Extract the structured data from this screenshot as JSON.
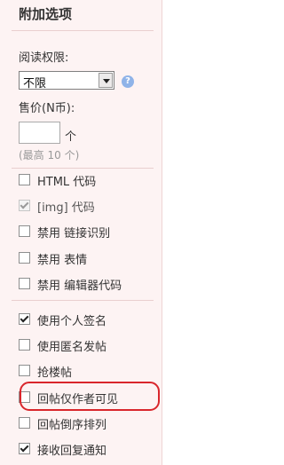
{
  "panel": {
    "title": "附加选项",
    "read_permission_label": "阅读权限:",
    "read_permission_value": "不限",
    "help_glyph": "?",
    "price_label": "售价(N币):",
    "price_value": "",
    "price_unit": "个",
    "price_hint": "(最高 10 个)",
    "options": [
      {
        "label": "HTML 代码",
        "checked": false,
        "disabled": false
      },
      {
        "label": "[img] 代码",
        "checked": true,
        "disabled": true
      },
      {
        "label": "禁用 链接识别",
        "checked": false,
        "disabled": false
      },
      {
        "label": "禁用 表情",
        "checked": false,
        "disabled": false
      },
      {
        "label": "禁用 编辑器代码",
        "checked": false,
        "disabled": false
      },
      {
        "label": "使用个人签名",
        "checked": true,
        "disabled": false
      },
      {
        "label": "使用匿名发帖",
        "checked": false,
        "disabled": false
      },
      {
        "label": "抢楼帖",
        "checked": false,
        "disabled": false
      },
      {
        "label": "回帖仅作者可见",
        "checked": false,
        "disabled": false
      },
      {
        "label": "回帖倒序排列",
        "checked": false,
        "disabled": false
      },
      {
        "label": "接收回复通知",
        "checked": true,
        "disabled": false
      }
    ],
    "highlight_color": "#d9262c"
  }
}
